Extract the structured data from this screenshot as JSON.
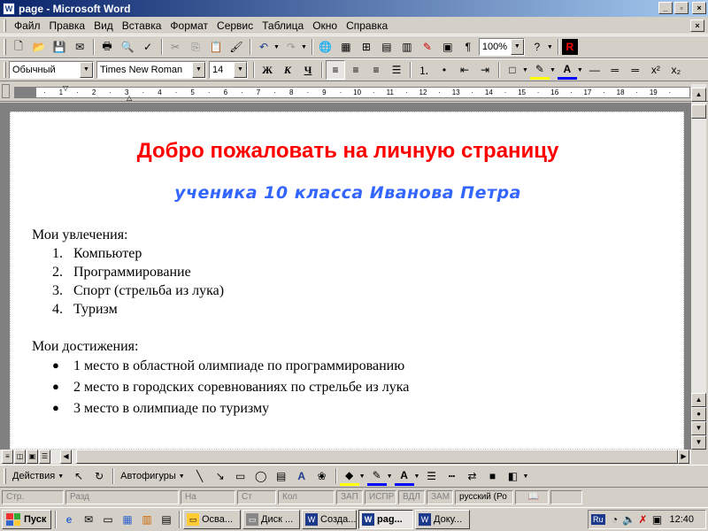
{
  "window": {
    "title": "page - Microsoft Word",
    "app_icon": "W",
    "controls": [
      "_",
      "▫",
      "×"
    ]
  },
  "menu": {
    "items": [
      "Файл",
      "Правка",
      "Вид",
      "Вставка",
      "Формат",
      "Сервис",
      "Таблица",
      "Окно",
      "Справка"
    ],
    "doc_close": "×"
  },
  "toolbar_standard": {
    "zoom": "100%"
  },
  "toolbar_format": {
    "style": "Обычный",
    "font": "Times New Roman",
    "size": "14",
    "bold": "Ж",
    "italic": "К",
    "underline": "Ч"
  },
  "ruler": {
    "ticks": [
      "·",
      "1",
      "·",
      "2",
      "·",
      "3",
      "·",
      "4",
      "·",
      "5",
      "·",
      "6",
      "·",
      "7",
      "·",
      "8",
      "·",
      "9",
      "·",
      "10",
      "·",
      "11",
      "·",
      "12",
      "·",
      "13",
      "·",
      "14",
      "·",
      "15",
      "·",
      "16",
      "·",
      "17",
      "·",
      "18",
      "·",
      "19",
      "·"
    ]
  },
  "document": {
    "heading": "Добро пожаловать на личную страницу",
    "subheading": "ученика 10 класса Иванова Петра",
    "section1_title": "Мои увлечения:",
    "hobbies": [
      {
        "num": "1.",
        "text": "Компьютер"
      },
      {
        "num": "2.",
        "text": "Программирование"
      },
      {
        "num": "3.",
        "text": "Спорт (стрельба из лука)"
      },
      {
        "num": "4.",
        "text": "Туризм"
      }
    ],
    "section2_title": "Мои достижения:",
    "achievements": [
      "1 место в областной олимпиаде по программированию",
      "2 место в городских соревнованиях по стрельбе из лука",
      "3 место в олимпиаде по туризму"
    ],
    "heading_color": "#ff0000",
    "subheading_color": "#3366ff"
  },
  "drawbar": {
    "actions": "Действия",
    "autoshapes": "Автофигуры"
  },
  "statusbar": {
    "page": "Стр.",
    "section": "Разд",
    "at": "На",
    "line": "Ст",
    "col": "Кол",
    "rec": "ЗАП",
    "trk": "ИСПР",
    "ext": "ВДЛ",
    "ovr": "ЗАМ",
    "lang": "русский (Ро"
  },
  "taskbar": {
    "start": "Пуск",
    "tasks": [
      {
        "label": "Осва...",
        "active": false
      },
      {
        "label": "Диск ...",
        "active": false
      },
      {
        "label": "Созда...",
        "active": false
      },
      {
        "label": "pag...",
        "active": true
      },
      {
        "label": "Доку...",
        "active": false
      }
    ],
    "lang": "Ru",
    "time": "12:40"
  }
}
